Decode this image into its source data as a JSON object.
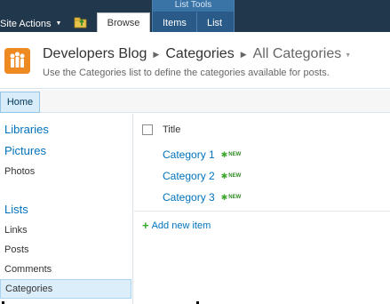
{
  "ribbon": {
    "site_actions_label": "Site Actions",
    "browse_tab_label": "Browse",
    "contextual_group_label": "List Tools",
    "contextual_tabs": [
      {
        "label": "Items"
      },
      {
        "label": "List"
      }
    ]
  },
  "title_area": {
    "breadcrumb": [
      "Developers Blog",
      "Categories",
      "All Categories"
    ],
    "description": "Use the Categories list to define the categories available for posts."
  },
  "top_link_bar": {
    "home_label": "Home"
  },
  "quick_launch": {
    "sections": [
      {
        "heading": "Libraries",
        "items": []
      },
      {
        "heading": "Pictures",
        "items": [
          "Photos"
        ]
      },
      {
        "heading": "Lists",
        "items": [
          "Links",
          "Posts",
          "Comments",
          "Categories"
        ]
      }
    ],
    "selected": "Categories"
  },
  "list_view": {
    "column_title": "Title",
    "items": [
      {
        "title": "Category 1",
        "badge": "NEW"
      },
      {
        "title": "Category 2",
        "badge": "NEW"
      },
      {
        "title": "Category 3",
        "badge": "NEW"
      }
    ],
    "add_new_label": "Add new item"
  },
  "colors": {
    "ribbon_bg": "#21374c",
    "contextual_group_bg": "#2a5a88",
    "link_blue": "#0072bc",
    "selected_bg": "#ddeefb"
  },
  "icons": {
    "navigate_up": "folder-up-arrow-icon",
    "site_logo": "people-logo-icon",
    "new_badge": "new-sparkle-icon",
    "add_item": "plus-icon"
  }
}
